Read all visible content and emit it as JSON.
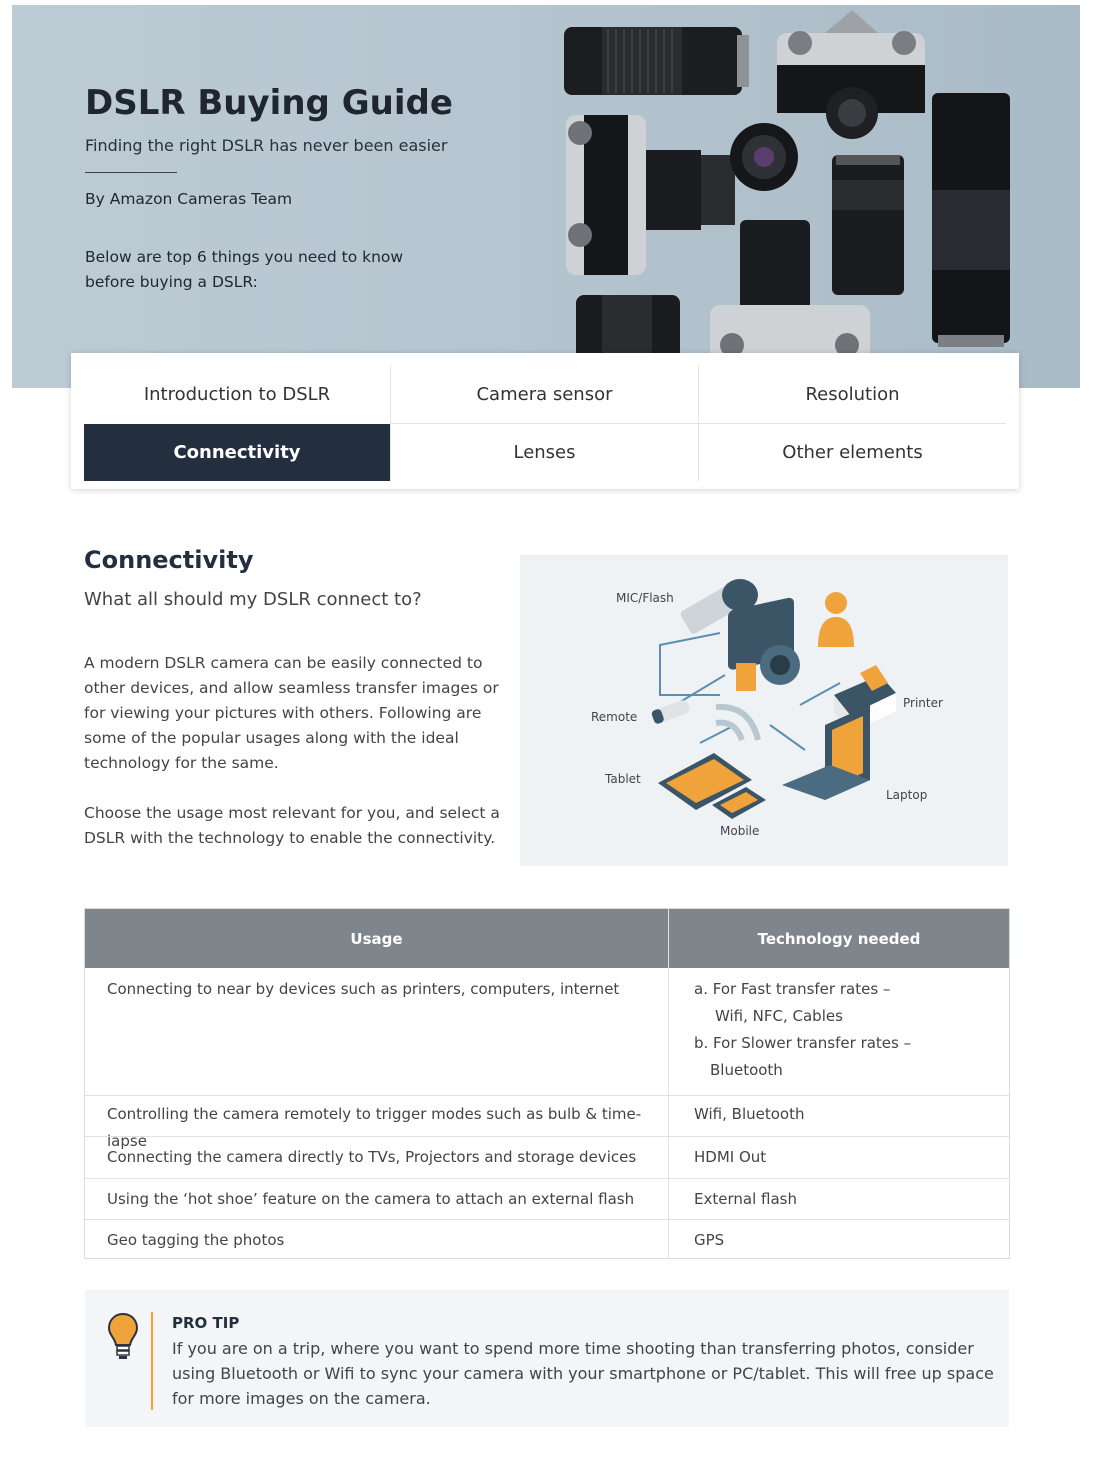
{
  "hero": {
    "title": "DSLR Buying Guide",
    "subtitle": "Finding the right DSLR has never been easier",
    "author": "By Amazon Cameras Team",
    "intro": "Below are top 6 things you need to know before buying a DSLR:"
  },
  "tabs": [
    {
      "label": "Introduction to DSLR",
      "active": false
    },
    {
      "label": "Camera sensor",
      "active": false
    },
    {
      "label": "Resolution",
      "active": false
    },
    {
      "label": "Connectivity",
      "active": true
    },
    {
      "label": "Lenses",
      "active": false
    },
    {
      "label": "Other elements",
      "active": false
    }
  ],
  "section": {
    "title": "Connectivity",
    "subtitle": "What all should my DSLR connect to?",
    "paragraph1": "A modern DSLR camera can be easily connected to other devices, and allow seamless transfer images or for viewing your pictures with others. Following are some of the popular usages along with the ideal technology for the same.",
    "paragraph2": "Choose the usage most relevant for you, and select a DSLR with the technology to enable the connectivity."
  },
  "diagram": {
    "labels": {
      "mic": "MIC/Flash",
      "remote": "Remote",
      "printer": "Printer",
      "tablet": "Tablet",
      "laptop": "Laptop",
      "mobile": "Mobile"
    }
  },
  "table": {
    "headers": [
      "Usage",
      "Technology needed"
    ],
    "rows": [
      {
        "usage": "Connecting to near by devices such as printers, computers, internet",
        "tech_lines": [
          "a.  For Fast transfer rates –",
          "Wifi, NFC, Cables",
          "b.  For Slower transfer rates –",
          "Bluetooth"
        ]
      },
      {
        "usage": "Controlling the camera remotely to trigger modes such as bulb & time-lapse",
        "tech": "Wifi, Bluetooth"
      },
      {
        "usage": "Connecting the camera directly to TVs, Projectors and storage devices",
        "tech": "HDMI Out"
      },
      {
        "usage": "Using the ‘hot shoe’ feature on the camera to attach an external flash",
        "tech": "External flash"
      },
      {
        "usage": "Geo tagging the photos",
        "tech": "GPS"
      }
    ]
  },
  "tip": {
    "label": "PRO TIP",
    "text": "If you are on a trip, where you want to spend more time shooting than transferring photos, consider using Bluetooth or Wifi to sync your camera with your smartphone or PC/tablet. This will free up space for more images on the camera."
  },
  "colors": {
    "navy": "#232f3e",
    "accent_orange": "#f0a23b",
    "table_header": "#7e868c",
    "hero_bg": "#b6c5cf"
  }
}
